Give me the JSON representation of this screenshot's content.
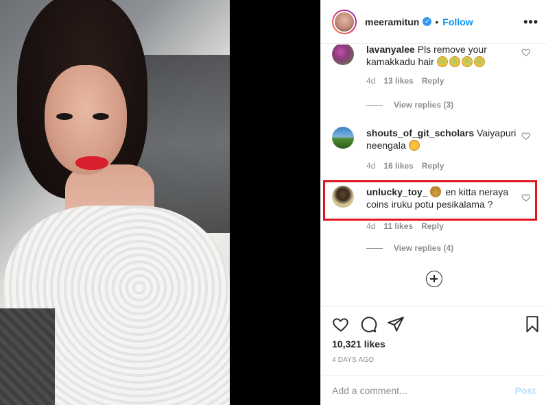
{
  "post": {
    "username": "meeramitun",
    "follow_label": "Follow",
    "separator": "•",
    "verified_glyph": "✓",
    "more_glyph": "•••"
  },
  "comments": [
    {
      "username": "lavanyalee",
      "text": "Pls remove your kamakkadu hair",
      "emojis": [
        "sick-face-emoji",
        "sick-face-emoji",
        "sick-face-emoji",
        "sick-face-emoji"
      ],
      "time": "4d",
      "likes": "13 likes",
      "reply": "Reply",
      "view_replies": "View replies (3)",
      "avatar_colors": [
        "#5f8a3a",
        "#c34ea8"
      ]
    },
    {
      "username": "shouts_of_git_scholars",
      "text": "Vaiyapuri neengala",
      "emojis": [
        "laughing-emoji"
      ],
      "time": "4d",
      "likes": "16 likes",
      "reply": "Reply",
      "avatar_colors": [
        "#3a7fc8",
        "#4d8a2e"
      ]
    },
    {
      "username": "unlucky_toy_",
      "text": "en kitta neraya coins iruku potu pesikalama ?",
      "emojis": [
        "money-bag-emoji"
      ],
      "time": "4d",
      "likes": "11 likes",
      "reply": "Reply",
      "view_replies": "View replies (4)",
      "avatar_colors": [
        "#d9c89a",
        "#5a4630"
      ]
    }
  ],
  "actions": {
    "likes": "10,321 likes",
    "time_ago": "4 DAYS AGO",
    "icons": [
      "heart-icon",
      "comment-icon",
      "share-icon",
      "bookmark-icon"
    ]
  },
  "add_comment": {
    "placeholder": "Add a comment...",
    "post_label": "Post"
  },
  "colors": {
    "accent": "#0095f6",
    "highlight": "#e3131b",
    "muted": "#8e8e8e"
  }
}
